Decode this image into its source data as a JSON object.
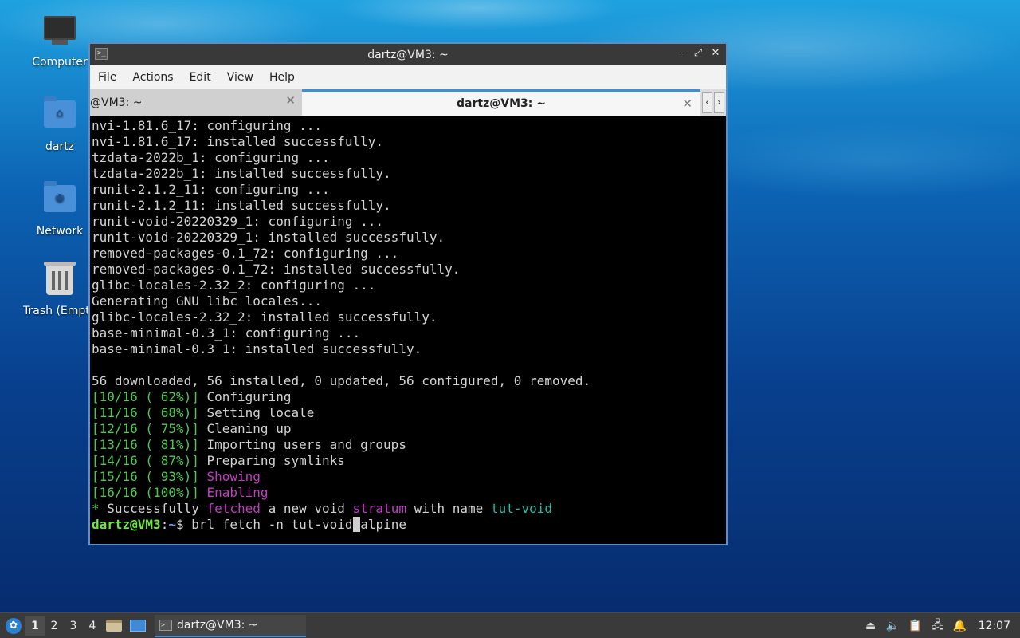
{
  "desktop": {
    "icons": [
      {
        "label": "Computer"
      },
      {
        "label": "dartz"
      },
      {
        "label": "Network"
      },
      {
        "label": "Trash (Empt"
      }
    ]
  },
  "window": {
    "title": "dartz@VM3: ~",
    "controls": {
      "minimize": "–",
      "maximize": "⤢",
      "close": "✕"
    },
    "menu": [
      "File",
      "Actions",
      "Edit",
      "View",
      "Help"
    ],
    "tabs": [
      {
        "label": "@VM3: ~",
        "close": "✕",
        "active": false
      },
      {
        "label": "dartz@VM3: ~",
        "close": "✕",
        "active": true
      }
    ],
    "tab_nav": {
      "prev": "‹",
      "next": "›"
    }
  },
  "terminal": {
    "plain_lines": [
      "nvi-1.81.6_17: configuring ...",
      "nvi-1.81.6_17: installed successfully.",
      "tzdata-2022b_1: configuring ...",
      "tzdata-2022b_1: installed successfully.",
      "runit-2.1.2_11: configuring ...",
      "runit-2.1.2_11: installed successfully.",
      "runit-void-20220329_1: configuring ...",
      "runit-void-20220329_1: installed successfully.",
      "removed-packages-0.1_72: configuring ...",
      "removed-packages-0.1_72: installed successfully.",
      "glibc-locales-2.32_2: configuring ...",
      "Generating GNU libc locales...",
      "glibc-locales-2.32_2: installed successfully.",
      "base-minimal-0.3_1: configuring ...",
      "base-minimal-0.3_1: installed successfully.",
      "",
      "56 downloaded, 56 installed, 0 updated, 56 configured, 0 removed."
    ],
    "progress": [
      {
        "tag": "[10/16 ( 62%)]",
        "text": " Configuring",
        "color": "#d3d3d3"
      },
      {
        "tag": "[11/16 ( 68%)]",
        "text": " Setting locale",
        "color": "#d3d3d3"
      },
      {
        "tag": "[12/16 ( 75%)]",
        "text": " Cleaning up",
        "color": "#d3d3d3"
      },
      {
        "tag": "[13/16 ( 81%)]",
        "text": " Importing users and groups",
        "color": "#d3d3d3"
      },
      {
        "tag": "[14/16 ( 87%)]",
        "text": " Preparing symlinks",
        "color": "#d3d3d3"
      },
      {
        "tag": "[15/16 ( 93%)]",
        "text": " Showing",
        "color": "#c43ac4"
      },
      {
        "tag": "[16/16 (100%)]",
        "text": " Enabling",
        "color": "#c43ac4"
      }
    ],
    "result": {
      "star": "*",
      "p1": " Successfully ",
      "w1": "fetched",
      "p2": " a new void ",
      "w2": "stratum",
      "p3": " with name ",
      "w3": "tut-void"
    },
    "prompt": {
      "user_host": "dartz@VM3",
      "sep": ":",
      "path": "~",
      "dollar": "$ ",
      "command_before": "brl fetch -n tut-void",
      "cursor_char": " ",
      "command_after": "alpine"
    }
  },
  "taskbar": {
    "start_icon": "✿",
    "workspaces": [
      "1",
      "2",
      "3",
      "4"
    ],
    "active_workspace": "1",
    "task_label": "dartz@VM3: ~",
    "clock": "12:07",
    "tray_icons": [
      "eject-icon",
      "volume-icon",
      "clipboard-icon",
      "network-icon",
      "notification-icon"
    ]
  },
  "colors": {
    "accent": "#3b8fd6",
    "prompt_user": "#6bea3a",
    "prompt_path": "#6aa0e8",
    "progress_tag": "#4cc94c",
    "highlight_magenta": "#c43ac4",
    "highlight_cyan": "#2eb8a6"
  }
}
